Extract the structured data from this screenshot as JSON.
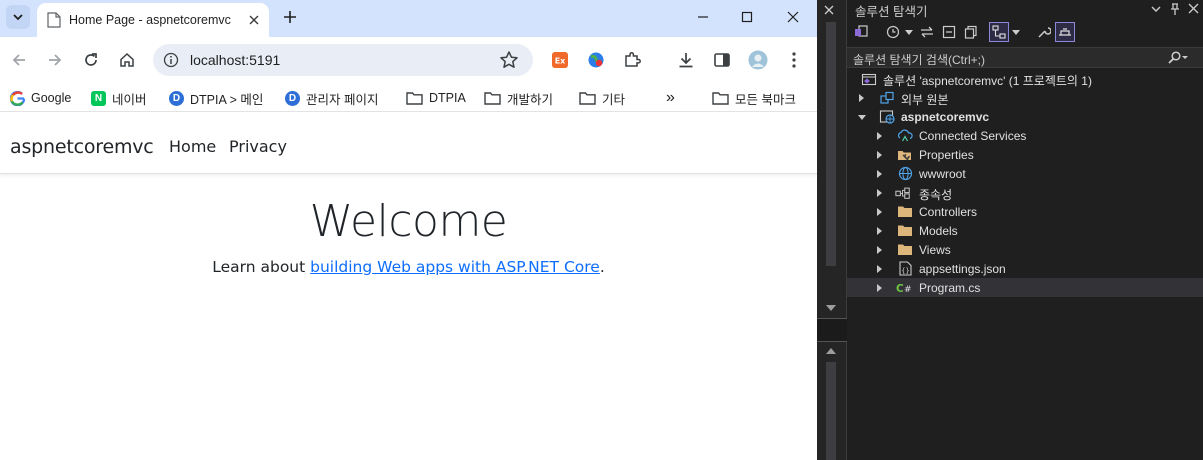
{
  "browser": {
    "tab": {
      "title": "Home Page - aspnetcoremvc"
    },
    "omnibox": {
      "url": "localhost:5191"
    },
    "bookmarks": [
      {
        "label": "Google",
        "icon": "google-icon"
      },
      {
        "label": "네이버",
        "icon": "naver-icon",
        "icon_text": "N"
      },
      {
        "label": "DTPIA > 메인",
        "icon": "dtpia-icon",
        "icon_text": "D"
      },
      {
        "label": "관리자 페이지",
        "icon": "dtpia-icon",
        "icon_text": "D"
      },
      {
        "label": "DTPIA",
        "icon": "folder-icon"
      },
      {
        "label": "개발하기",
        "icon": "folder-icon"
      },
      {
        "label": "기타",
        "icon": "folder-icon"
      }
    ],
    "bookmarks_overflow": "»",
    "all_bookmarks": "모든 북마크",
    "colors": {
      "tabstrip": "#d3e3fd",
      "link": "#0d6efd"
    }
  },
  "site": {
    "brand": "aspnetcoremvc",
    "nav": [
      "Home",
      "Privacy"
    ],
    "heading": "Welcome",
    "learn_prefix": "Learn about ",
    "learn_link": "building Web apps with ASP.NET Core",
    "learn_suffix": "."
  },
  "solution_explorer": {
    "title": "솔루션 탐색기",
    "search_placeholder": "솔루션 탐색기 검색(Ctrl+;)",
    "tree": [
      {
        "label": "솔루션 'aspnetcoremvc' (1 프로젝트의 1)",
        "icon": "solution-icon"
      },
      {
        "label": "외부 원본",
        "icon": "external-sources-icon"
      },
      {
        "label": "aspnetcoremvc",
        "icon": "web-project-icon"
      },
      {
        "label": "Connected Services",
        "icon": "connected-services-icon"
      },
      {
        "label": "Properties",
        "icon": "properties-icon"
      },
      {
        "label": "wwwroot",
        "icon": "globe-icon"
      },
      {
        "label": "종속성",
        "icon": "dependencies-icon"
      },
      {
        "label": "Controllers",
        "icon": "folder-icon"
      },
      {
        "label": "Models",
        "icon": "folder-icon"
      },
      {
        "label": "Views",
        "icon": "folder-icon"
      },
      {
        "label": "appsettings.json",
        "icon": "json-file-icon"
      },
      {
        "label": "Program.cs",
        "icon": "csharp-file-icon"
      }
    ],
    "colors": {
      "background": "#1f1f1f",
      "selected": "#333337",
      "folder": "#dcb67a"
    }
  }
}
